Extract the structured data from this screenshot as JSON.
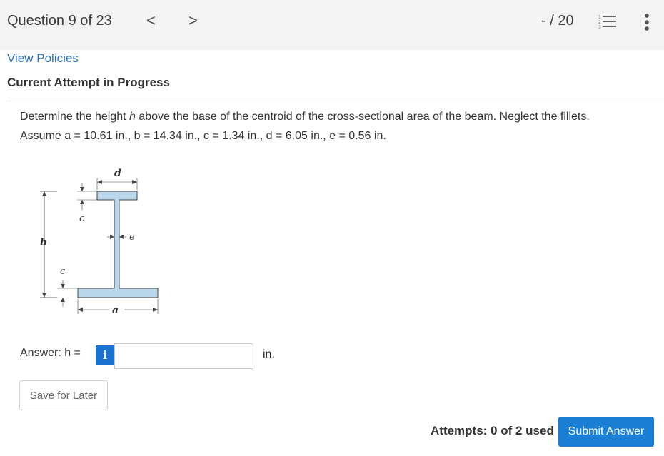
{
  "header": {
    "question_label": "Question 9 of 23",
    "prev_icon": "chevron-left-icon",
    "next_icon": "chevron-right-icon",
    "score": "- / 20",
    "list_icon": "question-list-icon",
    "more_icon": "more-vertical-icon"
  },
  "links": {
    "view_policies": "View Policies"
  },
  "status": {
    "attempt": "Current Attempt in Progress"
  },
  "question": {
    "line1_prefix": "Determine the height ",
    "line1_var": "h",
    "line1_suffix": " above the base of the centroid of the cross-sectional area of the beam. Neglect the fillets.",
    "line2": "Assume a = 10.61 in., b = 14.34 in., c = 1.34 in., d = 6.05 in., e = 0.56 in."
  },
  "figure": {
    "labels": {
      "a": "a",
      "b": "b",
      "c_top": "c",
      "c_bottom": "c",
      "d": "d",
      "e": "e"
    },
    "fill_color": "#b9d6ea"
  },
  "answer": {
    "label": "Answer: h =",
    "info_label": "i",
    "value": "",
    "unit": "in."
  },
  "buttons": {
    "save": "Save for Later",
    "submit": "Submit Answer"
  },
  "attempts": {
    "text": "Attempts: 0 of 2 used"
  },
  "colors": {
    "accent": "#1a7fd4",
    "link": "#2a6ebb",
    "header_bg": "#f3f3f3"
  }
}
